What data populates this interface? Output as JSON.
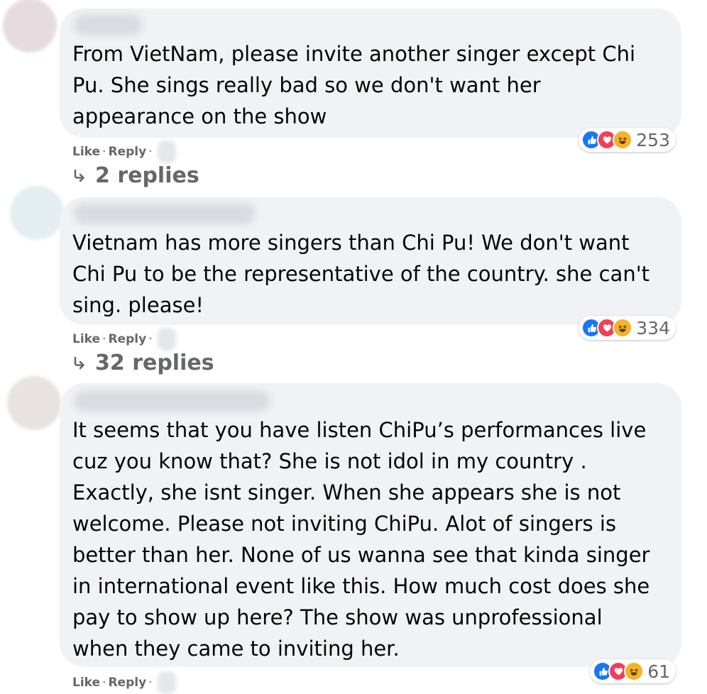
{
  "comments": [
    {
      "text": "From VietNam, please invite another singer except Chi Pu. She sings really bad so we don't want her appearance on the show",
      "reactions": "253",
      "replies": "2 replies"
    },
    {
      "text": "Vietnam has more singers than Chi Pu! We don't want Chi Pu to be the representative of the country. she can't sing. please!",
      "reactions": "334",
      "replies": "32 replies"
    },
    {
      "text": "It seems that you have listen ChiPu’s performances live cuz you know that? She is not idol in my country . Exactly, she isnt singer. When she appears she is not welcome. Please not inviting ChiPu. Alot of singers is better than her. None of us wanna see that kinda singer in international event like this. How much cost does she pay to show up here? The show was unprofessional when they came to inviting her.",
      "reactions": "61"
    }
  ],
  "actions": {
    "like": "Like",
    "reply": "Reply",
    "separator": "·"
  },
  "icons": {
    "like": "thumbs-up-icon",
    "love": "heart-icon",
    "haha": "laughing-face-icon",
    "replies": "reply-arrow-icon"
  },
  "colors": {
    "bubble": "#f0f2f5",
    "secondary_text": "#65676b",
    "like_blue": "#1877f2",
    "love_red": "#f33e58",
    "haha_yellow": "#f7b125"
  }
}
